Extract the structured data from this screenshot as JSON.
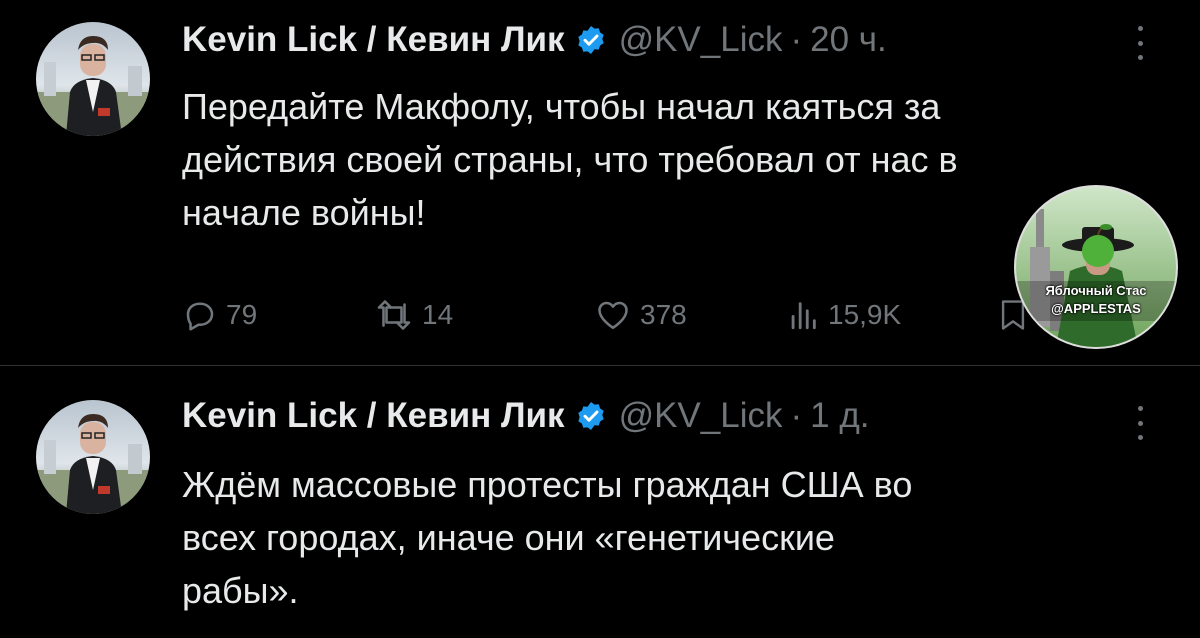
{
  "tweets": [
    {
      "author_name": "Kevin Lick / Кевин Лик",
      "handle": "@KV_Lick",
      "separator": "·",
      "time": "20 ч.",
      "text": "Передайте Макфолу, чтобы начал каяться за\nдействия своей страны, что требовал от нас в\nначале войны!",
      "stats": {
        "replies": "79",
        "retweets": "14",
        "likes": "378",
        "views": "15,9K"
      }
    },
    {
      "author_name": "Kevin Lick / Кевин Лик",
      "handle": "@KV_Lick",
      "separator": "·",
      "time": "1 д.",
      "text": "Ждём массовые протесты граждан США во\nвсех городах, иначе они «генетические\nрабы»."
    }
  ],
  "watermark": {
    "line1": "Яблочный Стас",
    "line2": "@APPLESTAS"
  },
  "icons": {
    "verified": "verified-badge-icon",
    "more": "more-vertical-icon",
    "reply": "reply-icon",
    "retweet": "retweet-icon",
    "like": "heart-icon",
    "views": "views-icon",
    "bookmark": "bookmark-icon"
  },
  "colors": {
    "background": "#000000",
    "text": "#e7e9ea",
    "secondary": "#71767b",
    "verified": "#1d9bf0",
    "divider": "#2f3336"
  }
}
